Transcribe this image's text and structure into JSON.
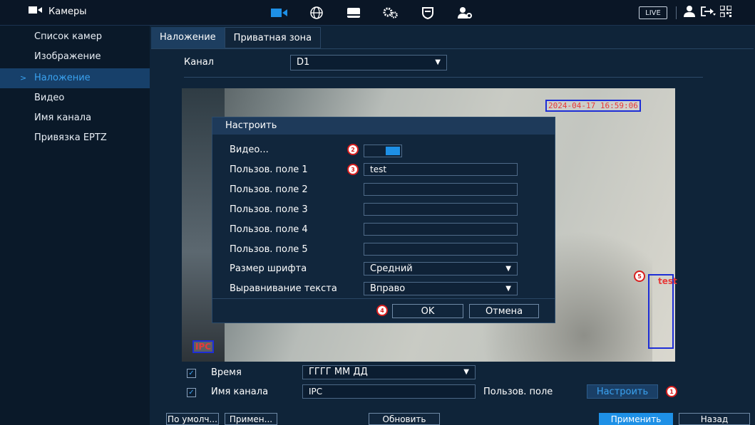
{
  "topbar": {
    "title": "Камеры",
    "live": "LIVE",
    "icons": [
      "camera-icon",
      "network-icon",
      "storage-icon",
      "settings-icon",
      "security-icon",
      "account-icon"
    ],
    "right_icons": [
      "user-icon",
      "logout-icon",
      "qr-icon"
    ]
  },
  "sidebar": {
    "items": [
      {
        "label": "Список камер"
      },
      {
        "label": "Изображение"
      },
      {
        "label": "Наложение"
      },
      {
        "label": "Видео"
      },
      {
        "label": "Имя канала"
      },
      {
        "label": "Привязка EPTZ"
      }
    ],
    "active_index": 2
  },
  "tabs": [
    {
      "label": "Наложение"
    },
    {
      "label": "Приватная зона"
    }
  ],
  "channel": {
    "label": "Канал",
    "value": "D1"
  },
  "preview": {
    "timestamp": "2024-04-17 16:59:06",
    "channel_name": "IPC",
    "custom_text": "test"
  },
  "dialog": {
    "title": "Настроить",
    "rows": [
      {
        "label": "Видео..."
      },
      {
        "label": "Пользов. поле 1",
        "value": "test"
      },
      {
        "label": "Пользов. поле 2",
        "value": ""
      },
      {
        "label": "Пользов. поле 3",
        "value": ""
      },
      {
        "label": "Пользов. поле 4",
        "value": ""
      },
      {
        "label": "Пользов. поле 5",
        "value": ""
      }
    ],
    "font_size": {
      "label": "Размер шрифта",
      "value": "Средний"
    },
    "alignment": {
      "label": "Выравнивание текста",
      "value": "Вправо"
    },
    "ok": "OK",
    "cancel": "Отмена",
    "toggle_on": true
  },
  "footer": {
    "time": {
      "label": "Время",
      "value": "ГГГГ ММ ДД",
      "checked": true
    },
    "channel_name": {
      "label": "Имя канала",
      "value": "IPC",
      "checked": true
    },
    "custom_field": {
      "label": "Пользов. поле",
      "button": "Настроить"
    }
  },
  "bottom_buttons": {
    "default": "По умолч...",
    "apply_to": "Примен...",
    "refresh": "Обновить",
    "apply": "Применить",
    "back": "Назад"
  },
  "markers": [
    "1",
    "2",
    "3",
    "4",
    "5"
  ],
  "colors": {
    "accent": "#1e90e6",
    "marker": "#d81e1e",
    "overlay_text": "#e63a3a",
    "overlay_box": "#1d2dd6"
  }
}
